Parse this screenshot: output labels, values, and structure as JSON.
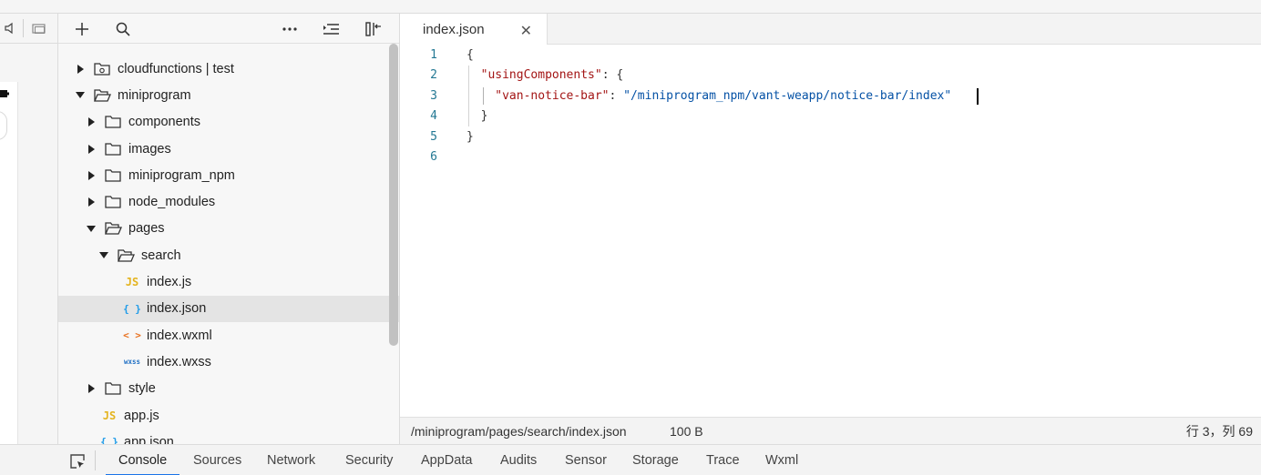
{
  "explorer": {
    "toolbar": {
      "add_icon": "plus-icon",
      "search_icon": "search-icon",
      "more_icon": "more-icon",
      "collapse_icon": "collapse-icon",
      "layout_icon": "layout-icon"
    },
    "tree": [
      {
        "label": "cloudfunctions | test",
        "depth": 0,
        "kind": "cloud-folder",
        "expanded": false
      },
      {
        "label": "miniprogram",
        "depth": 0,
        "kind": "folder",
        "expanded": true
      },
      {
        "label": "components",
        "depth": 1,
        "kind": "folder",
        "expanded": false
      },
      {
        "label": "images",
        "depth": 1,
        "kind": "folder",
        "expanded": false
      },
      {
        "label": "miniprogram_npm",
        "depth": 1,
        "kind": "folder",
        "expanded": false
      },
      {
        "label": "node_modules",
        "depth": 1,
        "kind": "folder",
        "expanded": false
      },
      {
        "label": "pages",
        "depth": 1,
        "kind": "folder",
        "expanded": true
      },
      {
        "label": "search",
        "depth": 2,
        "kind": "folder",
        "expanded": true
      },
      {
        "label": "index.js",
        "depth": 3,
        "kind": "js",
        "ext": "JS"
      },
      {
        "label": "index.json",
        "depth": 3,
        "kind": "json",
        "ext": "{ }",
        "selected": true
      },
      {
        "label": "index.wxml",
        "depth": 3,
        "kind": "wxml",
        "ext": "< >"
      },
      {
        "label": "index.wxss",
        "depth": 3,
        "kind": "wxss",
        "ext": "wxss"
      },
      {
        "label": "style",
        "depth": 1,
        "kind": "folder",
        "expanded": false
      },
      {
        "label": "app.js",
        "depth": 1,
        "kind": "js",
        "ext": "JS"
      },
      {
        "label": "app.json",
        "depth": 1,
        "kind": "json",
        "ext": "{ }"
      }
    ]
  },
  "editor": {
    "tab_label": "index.json",
    "close_glyph": "✕",
    "lines": [
      {
        "num": "1",
        "parts": [
          {
            "t": "{",
            "c": "p"
          }
        ]
      },
      {
        "num": "2",
        "parts": [
          {
            "t": "\"usingComponents\"",
            "c": "key"
          },
          {
            "t": ": {",
            "c": "p"
          }
        ]
      },
      {
        "num": "3",
        "parts": [
          {
            "t": "\"van-notice-bar\"",
            "c": "key"
          },
          {
            "t": ": ",
            "c": "p"
          },
          {
            "t": "\"/miniprogram_npm/vant-weapp/notice-bar/index\"",
            "c": "str"
          }
        ]
      },
      {
        "num": "4",
        "parts": [
          {
            "t": "}",
            "c": "p"
          }
        ]
      },
      {
        "num": "5",
        "parts": [
          {
            "t": "}",
            "c": "p"
          }
        ]
      },
      {
        "num": "6",
        "parts": []
      }
    ]
  },
  "statusbar": {
    "path": "/miniprogram/pages/search/index.json",
    "size": "100 B",
    "position": "行 3，列 69"
  },
  "bottom_tabs": {
    "tabs": [
      "Console",
      "Sources",
      "Network",
      "Security",
      "AppData",
      "Audits",
      "Sensor",
      "Storage",
      "Trace",
      "Wxml"
    ],
    "active": "Console"
  },
  "colors": {
    "accent": "#1a73e8",
    "json_key": "#a31515",
    "json_string": "#0451a5",
    "line_number": "#237893"
  }
}
